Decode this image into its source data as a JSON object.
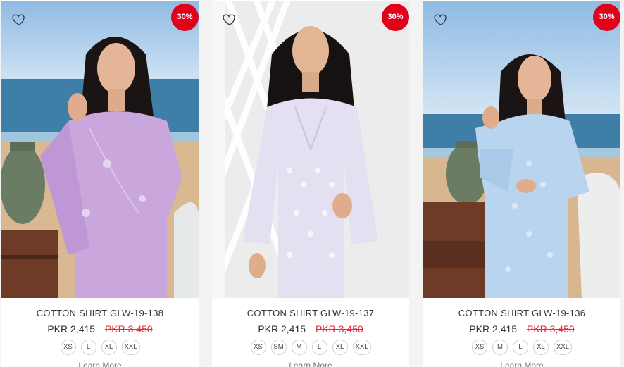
{
  "products": [
    {
      "discount": "30%",
      "title": "COTTON SHIRT GLW-19-138",
      "price": "PKR 2,415",
      "old_price": "PKR 3,450",
      "sizes": [
        "XS",
        "L",
        "XL",
        "XXL"
      ],
      "learn_more": "Learn More",
      "shirt_color": "#c9a6dc",
      "background": "beach"
    },
    {
      "discount": "30%",
      "title": "COTTON SHIRT GLW-19-137",
      "price": "PKR 2,415",
      "old_price": "PKR 3,450",
      "sizes": [
        "XS",
        "SM",
        "M",
        "L",
        "XL",
        "XXL"
      ],
      "learn_more": "Learn More",
      "shirt_color": "#e4e0f2",
      "background": "studio-lattice"
    },
    {
      "discount": "30%",
      "title": "COTTON SHIRT GLW-19-136",
      "price": "PKR 2,415",
      "old_price": "PKR 3,450",
      "sizes": [
        "XS",
        "M",
        "L",
        "XL",
        "XXL"
      ],
      "learn_more": "Learn More",
      "shirt_color": "#b9d4ee",
      "background": "beach"
    }
  ],
  "icons": {
    "wishlist": "heart-outline-icon"
  },
  "colors": {
    "badge": "#e3001b",
    "old_price": "#e0303c"
  }
}
